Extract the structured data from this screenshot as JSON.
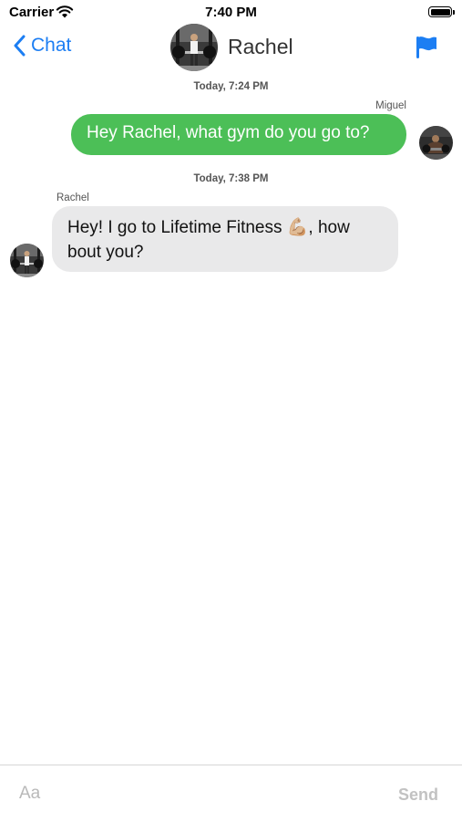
{
  "status_bar": {
    "carrier": "Carrier",
    "time": "7:40 PM"
  },
  "nav": {
    "back_label": "Chat",
    "title": "Rachel",
    "flag_color": "#1c7ef3",
    "accent": "#1c7ef3"
  },
  "messages": [
    {
      "timestamp": "Today, 7:24 PM",
      "sender": "Miguel",
      "text": "Hey Rachel, what gym do you go to?",
      "direction": "outgoing",
      "bubble_color": "#4cbf57"
    },
    {
      "timestamp": "Today, 7:38 PM",
      "sender": "Rachel",
      "text": "Hey! I go to Lifetime Fitness 💪🏼, how bout you?",
      "direction": "incoming",
      "bubble_color": "#e9e9ea"
    }
  ],
  "composer": {
    "placeholder": "Aa",
    "send_label": "Send"
  }
}
